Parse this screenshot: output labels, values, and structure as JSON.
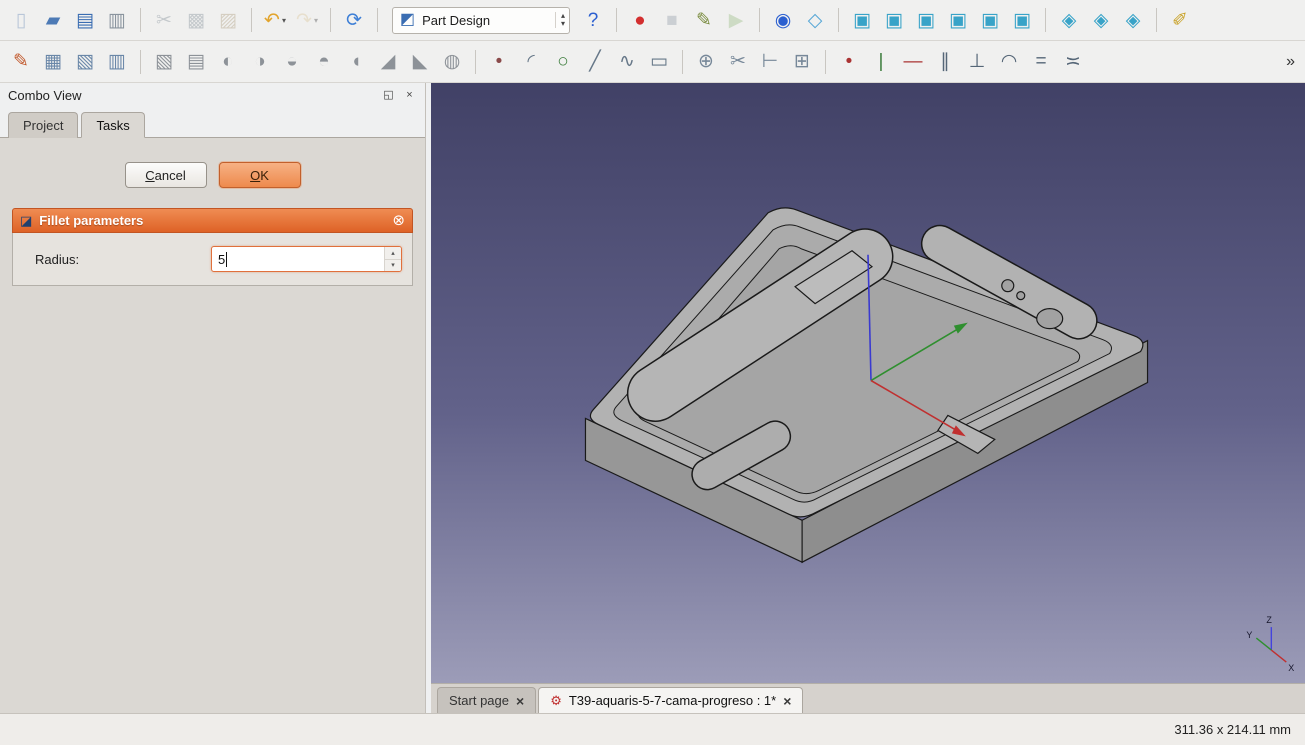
{
  "glyphs": {
    "up": "▴",
    "down": "▾",
    "dropdown": "▾",
    "overflow": "»",
    "close": "×"
  },
  "workbench": {
    "icon": "◩",
    "value": "Part Design"
  },
  "toolbar_main": {
    "items_left": [
      {
        "name": "new-file",
        "glyph": "▯",
        "color": "#b9c6d8"
      },
      {
        "name": "open-file",
        "glyph": "▰",
        "color": "#4d7ab5"
      },
      {
        "name": "save",
        "glyph": "▤",
        "color": "#3a6db2"
      },
      {
        "name": "print",
        "glyph": "▥",
        "color": "#8a949e"
      },
      {
        "sep": true
      },
      {
        "name": "cut",
        "glyph": "✂",
        "color": "#8a949e",
        "disabled": true
      },
      {
        "name": "copy",
        "glyph": "▩",
        "color": "#8a949e",
        "disabled": true
      },
      {
        "name": "paste",
        "glyph": "▨",
        "color": "#b0a184",
        "disabled": true
      },
      {
        "sep": true
      },
      {
        "name": "undo",
        "glyph": "↶",
        "color": "#e2a42c",
        "dropdown": true
      },
      {
        "name": "redo",
        "glyph": "↷",
        "color": "#dcc9a0",
        "disabled": true,
        "dropdown": true
      },
      {
        "sep": true
      },
      {
        "name": "refresh",
        "glyph": "⟳",
        "color": "#3e7fd6"
      },
      {
        "sep": true
      }
    ],
    "items_right": [
      {
        "name": "whats-this",
        "glyph": "?",
        "color": "#2b5fd0"
      },
      {
        "sep": true
      },
      {
        "name": "macro-record",
        "glyph": "●",
        "color": "#d32f2f"
      },
      {
        "name": "macro-stop",
        "glyph": "■",
        "color": "#9aa4ad",
        "disabled": true
      },
      {
        "name": "macro-edit",
        "glyph": "✎",
        "color": "#7a8c3f"
      },
      {
        "name": "macro-play",
        "glyph": "▶",
        "color": "#9fc08a",
        "disabled": true
      },
      {
        "sep": true
      },
      {
        "name": "zoom-fit-all",
        "glyph": "◉",
        "color": "#2b5fd0"
      },
      {
        "name": "view-axonometric",
        "glyph": "◇",
        "color": "#57a7d6"
      },
      {
        "sep": true
      },
      {
        "name": "view-front",
        "glyph": "▣",
        "color": "#38a3c8"
      },
      {
        "name": "view-top",
        "glyph": "▣",
        "color": "#38a3c8"
      },
      {
        "name": "view-right",
        "glyph": "▣",
        "color": "#38a3c8"
      },
      {
        "name": "view-rear",
        "glyph": "▣",
        "color": "#38a3c8"
      },
      {
        "name": "view-bottom",
        "glyph": "▣",
        "color": "#38a3c8"
      },
      {
        "name": "view-left",
        "glyph": "▣",
        "color": "#38a3c8"
      },
      {
        "sep": true
      },
      {
        "name": "view-isometric",
        "glyph": "◈",
        "color": "#38a3c8"
      },
      {
        "name": "view-dimetric",
        "glyph": "◈",
        "color": "#38a3c8"
      },
      {
        "name": "view-trimetric",
        "glyph": "◈",
        "color": "#38a3c8"
      },
      {
        "sep": true
      },
      {
        "name": "measure-distance",
        "glyph": "✐",
        "color": "#c9a227"
      }
    ]
  },
  "toolbar_tools": {
    "items": [
      {
        "name": "create-sketch",
        "glyph": "✎",
        "color": "#c25a2e"
      },
      {
        "name": "edit-sketch",
        "glyph": "▦",
        "color": "#6a87a8"
      },
      {
        "name": "map-sketch-to-face",
        "glyph": "▧",
        "color": "#6a87a8"
      },
      {
        "name": "leave-sketch",
        "glyph": "▥",
        "color": "#6a87a8"
      },
      {
        "sep": true
      },
      {
        "name": "pad",
        "glyph": "▧",
        "color": "#8d9298"
      },
      {
        "name": "pocket",
        "glyph": "▤",
        "color": "#8d9298"
      },
      {
        "name": "revolution",
        "glyph": "◐",
        "color": "#8d9298"
      },
      {
        "name": "groove",
        "glyph": "◑",
        "color": "#8d9298"
      },
      {
        "name": "additive-loft",
        "glyph": "◒",
        "color": "#8d9298"
      },
      {
        "name": "subtractive-loft",
        "glyph": "◓",
        "color": "#8d9298"
      },
      {
        "name": "fillet",
        "glyph": "◖",
        "color": "#8d9298"
      },
      {
        "name": "chamfer",
        "glyph": "◢",
        "color": "#8d9298"
      },
      {
        "name": "draft",
        "glyph": "◣",
        "color": "#8d9298"
      },
      {
        "name": "thickness",
        "glyph": "◍",
        "color": "#8d9298"
      },
      {
        "sep": true
      },
      {
        "name": "sketch-point",
        "glyph": "•",
        "color": "#8a4a4a"
      },
      {
        "name": "sketch-arc",
        "glyph": "◜",
        "color": "#667788"
      },
      {
        "name": "sketch-circle",
        "glyph": "○",
        "color": "#3f7f3f"
      },
      {
        "name": "sketch-line",
        "glyph": "╱",
        "color": "#667788"
      },
      {
        "name": "sketch-spline",
        "glyph": "∿",
        "color": "#667788"
      },
      {
        "name": "sketch-rectangle",
        "glyph": "▭",
        "color": "#667788"
      },
      {
        "sep": true
      },
      {
        "name": "constrain-lock",
        "glyph": "⊕",
        "color": "#778899"
      },
      {
        "name": "trim-edge",
        "glyph": "✂",
        "color": "#778899"
      },
      {
        "name": "extend-edge",
        "glyph": "⊢",
        "color": "#778899"
      },
      {
        "name": "external-geometry",
        "glyph": "⊞",
        "color": "#778899"
      },
      {
        "sep": true
      },
      {
        "name": "constrain-coincident",
        "glyph": "•",
        "color": "#aa3333"
      },
      {
        "name": "constrain-vertical",
        "glyph": "|",
        "color": "#3f7f3f"
      },
      {
        "name": "constrain-horizontal",
        "glyph": "—",
        "color": "#aa3333"
      },
      {
        "name": "constrain-parallel",
        "glyph": "∥",
        "color": "#556677"
      },
      {
        "name": "constrain-perpendicular",
        "glyph": "⊥",
        "color": "#556677"
      },
      {
        "name": "constrain-tangent",
        "glyph": "◠",
        "color": "#556677"
      },
      {
        "name": "constrain-equal",
        "glyph": "=",
        "color": "#556677"
      },
      {
        "name": "constrain-symmetric",
        "glyph": "≍",
        "color": "#556677"
      }
    ]
  },
  "combo_view": {
    "title": "Combo View",
    "float_glyph": "◱",
    "close_glyph": "×",
    "tabs": [
      {
        "label": "Project",
        "active": false
      },
      {
        "label": "Tasks",
        "active": true
      }
    ],
    "task": {
      "cancel_label": "Cancel",
      "ok_label": "OK",
      "section": {
        "icon_glyph": "◪",
        "title": "Fillet parameters",
        "collapse_glyph": "⊗"
      },
      "radius_label": "Radius:",
      "radius_value": "5"
    }
  },
  "viewport": {
    "mdi_tabs": [
      {
        "label": "Start page",
        "active": false
      },
      {
        "label": "T39-aquaris-5-7-cama-progreso : 1*",
        "icon": "⚙",
        "active": true
      }
    ],
    "mini_axis": {
      "x": "X",
      "y": "Y",
      "z": "Z"
    }
  },
  "statusbar": {
    "dimensions": "311.36 x 214.11 mm"
  },
  "colors": {
    "accent_orange": "#e8703a",
    "header_gradient_top": "#ef8c53",
    "header_gradient_bottom": "#de6226",
    "viewport_top": "#414166",
    "viewport_bottom": "#9c9cb8",
    "model_gray": "#b2b2b2"
  }
}
